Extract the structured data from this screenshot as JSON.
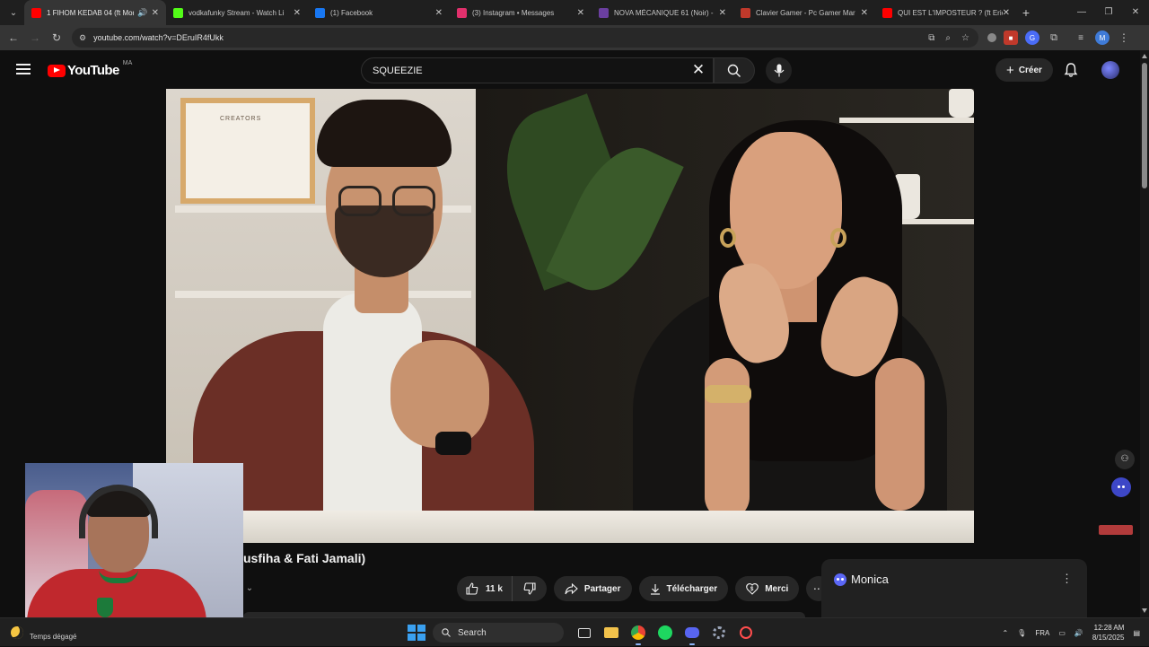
{
  "browser": {
    "tabs": [
      {
        "title": "1 FIHOM KEDAB 04 (ft Mon",
        "active": true,
        "favicon": "youtube-icon",
        "color": "#ff0000",
        "audio": true
      },
      {
        "title": "vodkafunky Stream - Watch Li",
        "active": false,
        "favicon": "kick-icon",
        "color": "#53fc18"
      },
      {
        "title": "(1) Facebook",
        "active": false,
        "favicon": "facebook-icon",
        "color": "#1877f2"
      },
      {
        "title": "(3) Instagram • Messages",
        "active": false,
        "favicon": "instagram-icon",
        "color": "#e1306c"
      },
      {
        "title": "NOVA MÉCANIQUE 61 (Noir) -",
        "active": false,
        "favicon": "nova-icon",
        "color": "#6b3fa0"
      },
      {
        "title": "Clavier Gamer - Pc Gamer Mar",
        "active": false,
        "favicon": "store-icon",
        "color": "#c0392b"
      },
      {
        "title": "QUI EST L'IMPOSTEUR ? (ft Eric",
        "active": false,
        "favicon": "youtube-icon",
        "color": "#ff0000"
      }
    ],
    "url": "youtube.com/watch?v=DEruIR4fUkk"
  },
  "youtube": {
    "logo_text": "YouTube",
    "country_code": "MA",
    "search_value": "SQUEEZIE",
    "create_label": "Créer",
    "video_title": "usfiha & Fati Jamali)",
    "like_count": "11 k",
    "share_label": "Partager",
    "download_label": "Télécharger",
    "thanks_label": "Merci",
    "frame_text": "CREATORS"
  },
  "monica": {
    "title": "Monica"
  },
  "taskbar": {
    "weather_text": "Temps dégagé",
    "search_label": "Search",
    "language": "FRA",
    "time": "12:28 AM",
    "date": "8/15/2025"
  },
  "colors": {
    "yt_red": "#ff0000",
    "page_bg": "#0f0f0f",
    "pill_bg": "#272727",
    "monica_accent": "#5b67f6"
  }
}
